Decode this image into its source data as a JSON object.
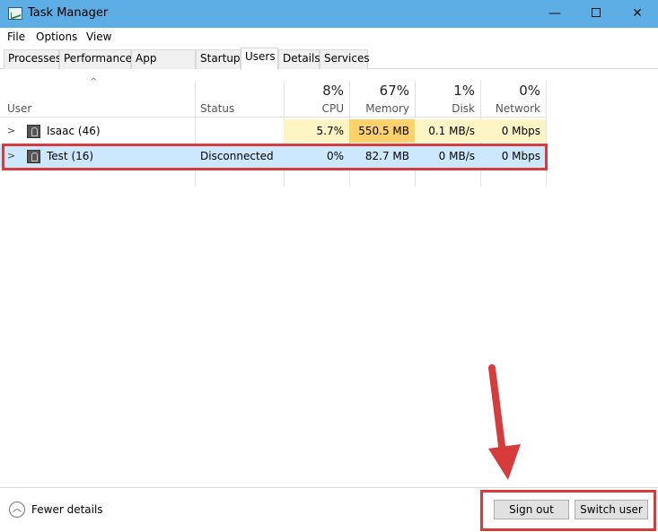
{
  "window": {
    "title": "Task Manager",
    "min_glyph": "—",
    "close_glyph": "✕"
  },
  "menu": [
    "File",
    "Options",
    "View"
  ],
  "tabs": [
    "Processes",
    "Performance",
    "App history",
    "Startup",
    "Users",
    "Details",
    "Services"
  ],
  "active_tab": "Users",
  "columns": {
    "sort_indicator": "^",
    "user": "User",
    "status": "Status",
    "cpu": {
      "pct": "8%",
      "name": "CPU"
    },
    "memory": {
      "pct": "67%",
      "name": "Memory"
    },
    "disk": {
      "pct": "1%",
      "name": "Disk"
    },
    "network": {
      "pct": "0%",
      "name": "Network"
    }
  },
  "rows": [
    {
      "expander": ">",
      "user": "Isaac (46)",
      "status": "",
      "cpu": "5.7%",
      "memory": "550.5 MB",
      "disk": "0.1 MB/s",
      "network": "0 Mbps"
    },
    {
      "expander": ">",
      "user": "Test (16)",
      "status": "Disconnected",
      "cpu": "0%",
      "memory": "82.7 MB",
      "disk": "0 MB/s",
      "network": "0 Mbps"
    }
  ],
  "footer": {
    "fewer_details": "Fewer details",
    "sign_out": "Sign out",
    "switch_user": "Switch user",
    "fewer_icon": "︿"
  },
  "colors": {
    "titlebar": "#5eaee6",
    "heat_low": "#fff4c4",
    "heat_high": "#ffd16b",
    "selected_row": "#cce8ff",
    "annotation_red": "#d73b3b"
  },
  "icons": [
    "taskmanager-app-icon",
    "user-avatar-icon",
    "chevron-right-icon",
    "chevron-up-circle-icon"
  ]
}
